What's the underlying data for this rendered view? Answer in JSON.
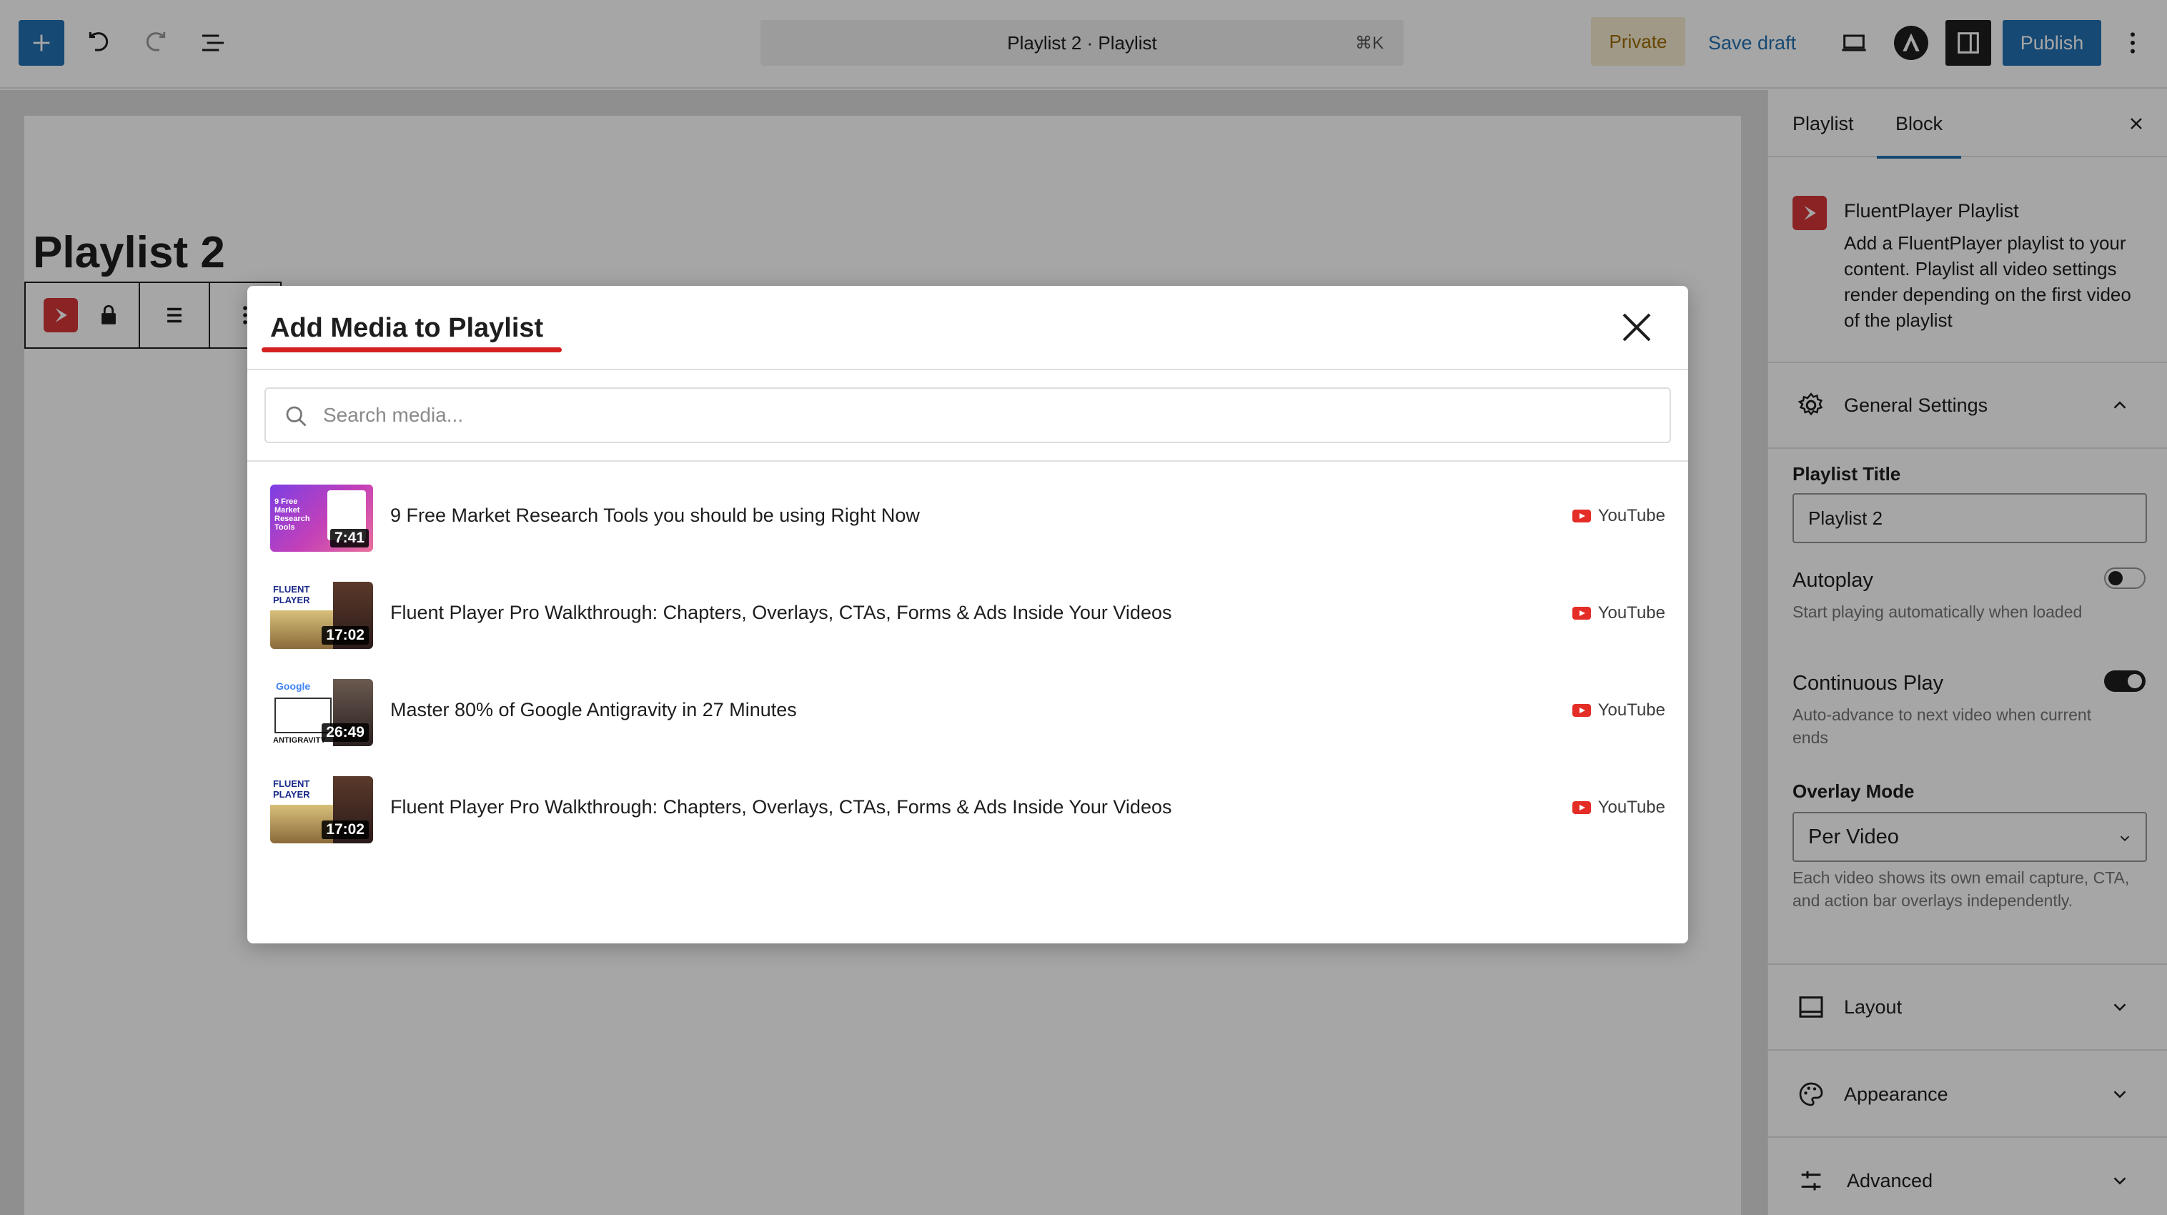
{
  "topbar": {
    "doc_title": "Playlist 2 · Playlist",
    "doc_shortcut": "⌘K",
    "private_label": "Private",
    "save_draft_label": "Save draft",
    "publish_label": "Publish"
  },
  "editor": {
    "post_title": "Playlist 2"
  },
  "sidebar": {
    "tabs": [
      {
        "label": "Playlist"
      },
      {
        "label": "Block"
      }
    ],
    "active_tab": "Block",
    "block_name": "FluentPlayer Playlist",
    "block_description": "Add a FluentPlayer playlist to your content. Playlist all video settings render depending on the first video of the playlist",
    "general_settings": {
      "label": "General Settings",
      "playlist_title_label": "Playlist Title",
      "playlist_title_value": "Playlist 2",
      "autoplay_label": "Autoplay",
      "autoplay_help": "Start playing automatically when loaded",
      "autoplay_on": false,
      "continuous_label": "Continuous Play",
      "continuous_help": "Auto-advance to next video when current ends",
      "continuous_on": true,
      "overlay_label": "Overlay Mode",
      "overlay_value": "Per Video",
      "overlay_help": "Each video shows its own email capture, CTA, and action bar overlays independently."
    },
    "panels": [
      {
        "label": "Layout",
        "icon": "layout-icon"
      },
      {
        "label": "Appearance",
        "icon": "palette-icon"
      },
      {
        "label": "Advanced",
        "icon": "sliders-icon"
      }
    ]
  },
  "modal": {
    "title": "Add Media to Playlist",
    "search_placeholder": "Search media...",
    "items": [
      {
        "title": "9 Free Market Research Tools you should be using Right Now",
        "duration": "7:41",
        "source": "YouTube",
        "thumb_text": "9 Free Market Research Tools"
      },
      {
        "title": "Fluent Player Pro Walkthrough: Chapters, Overlays, CTAs, Forms & Ads Inside Your Videos",
        "duration": "17:02",
        "source": "YouTube",
        "thumb_text": "FLUENT PLAYER"
      },
      {
        "title": "Master 80% of Google Antigravity in 27 Minutes",
        "duration": "26:49",
        "source": "YouTube",
        "thumb_text": "Google",
        "thumb_text_2": "ANTIGRAVITY"
      },
      {
        "title": "Fluent Player Pro Walkthrough: Chapters, Overlays, CTAs, Forms & Ads Inside Your Videos",
        "duration": "17:02",
        "source": "YouTube",
        "thumb_text": "FLUENT PLAYER"
      }
    ]
  },
  "colors": {
    "accent": "#2271b1",
    "brand_red": "#d63638",
    "underline_red": "#d61f1f",
    "youtube_red": "#e52d27"
  }
}
